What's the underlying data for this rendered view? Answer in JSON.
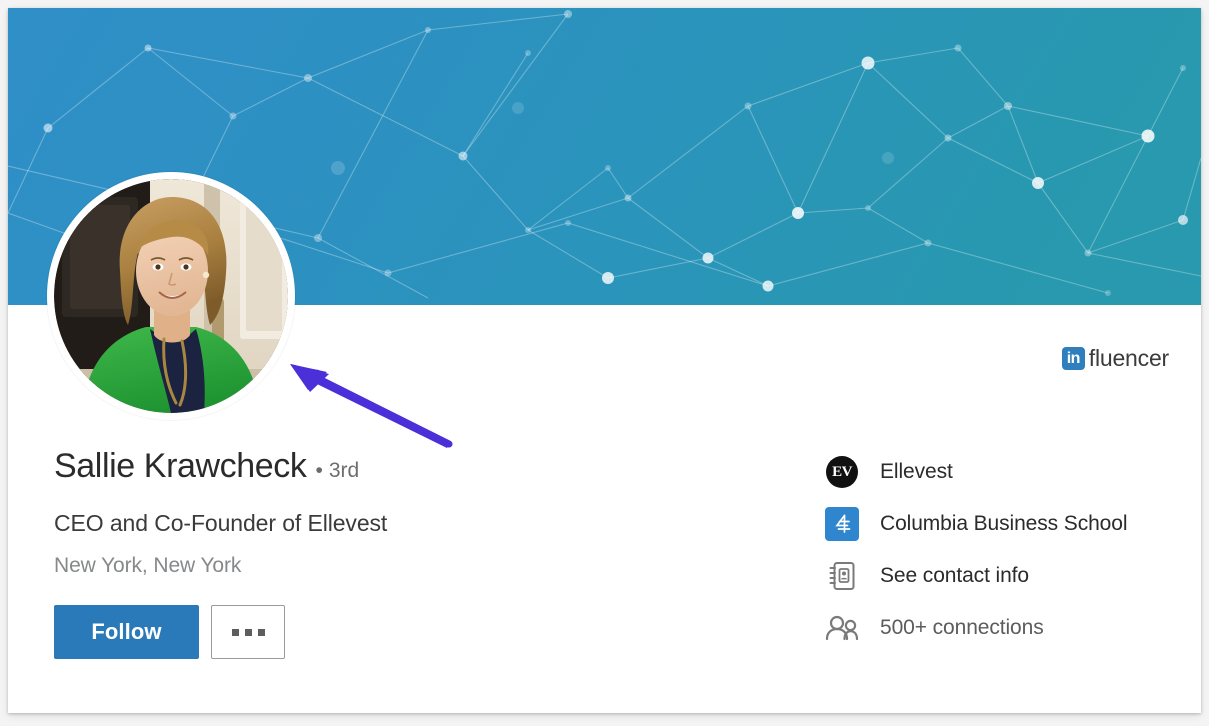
{
  "profile": {
    "name": "Sallie Krawcheck",
    "degree_separator": "•",
    "degree": "3rd",
    "headline": "CEO and Co-Founder of Ellevest",
    "location": "New York, New York",
    "avatar_alt": "Sallie Krawcheck profile photo"
  },
  "badge": {
    "logo_text": "in",
    "word": "fluencer"
  },
  "actions": {
    "follow_label": "Follow",
    "more_label": "More actions"
  },
  "info": {
    "rows": [
      {
        "icon": "ellevest-logo-icon",
        "label": "Ellevest",
        "mark_text": "EV"
      },
      {
        "icon": "columbia-crown-icon",
        "label": "Columbia Business School",
        "mark_text": ""
      },
      {
        "icon": "contact-card-icon",
        "label": "See contact info",
        "mark_text": ""
      },
      {
        "icon": "connections-people-icon",
        "label": "500+ connections",
        "mark_text": ""
      }
    ]
  },
  "annotation": {
    "type": "arrow",
    "points_to": "profile-avatar",
    "color": "#4b2fd8"
  },
  "colors": {
    "banner_left": "#2e8fc4",
    "banner_right": "#2899ae",
    "follow_button": "#2a7ab9",
    "linkedin_blue": "#2f7fbe",
    "arrow_purple": "#4b2fd8",
    "page_background": "#f4f4f4",
    "card_background": "#ffffff"
  }
}
